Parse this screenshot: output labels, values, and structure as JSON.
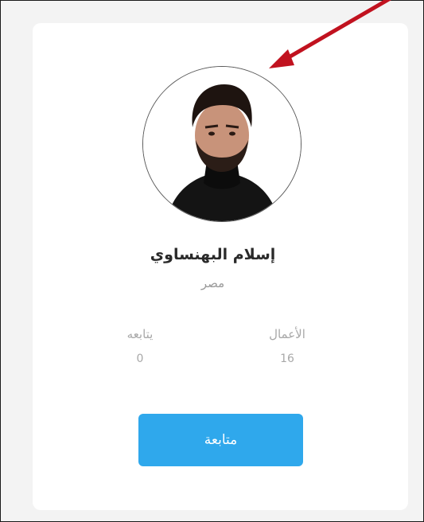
{
  "profile": {
    "name": "إسلام البهنساوي",
    "country": "مصر"
  },
  "stats": {
    "works_label": "الأعمال",
    "works_value": "16",
    "followers_label": "يتابعه",
    "followers_value": "0"
  },
  "actions": {
    "follow_label": "متابعة"
  },
  "colors": {
    "accent": "#2fa8ec",
    "annotation_arrow": "#c1121f"
  },
  "icons": {
    "annotation": "red-arrow-icon"
  }
}
